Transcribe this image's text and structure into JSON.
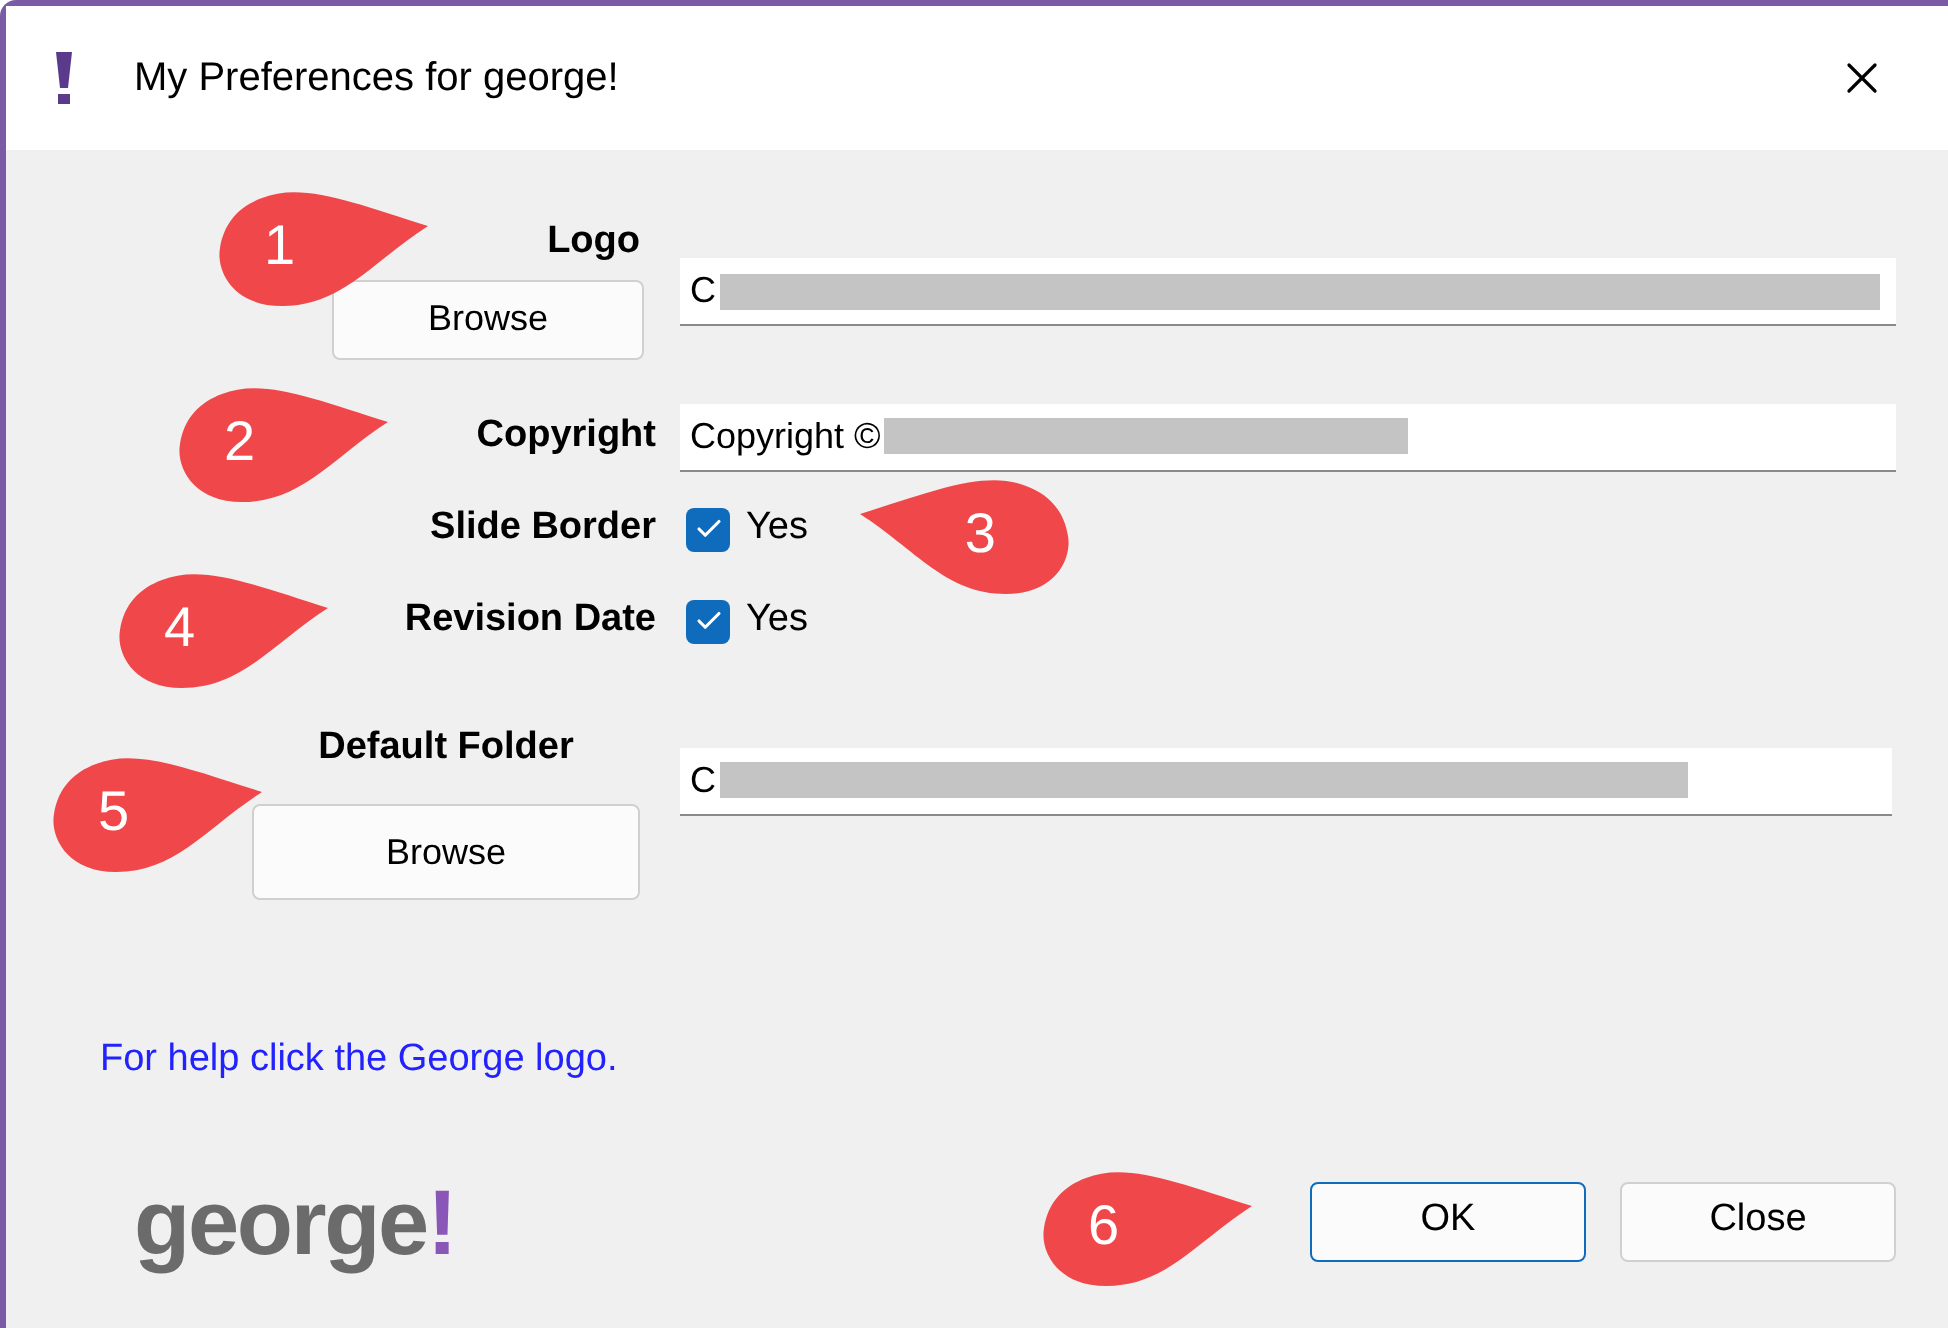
{
  "window": {
    "title": "My Preferences for george!"
  },
  "form": {
    "logo": {
      "label": "Logo",
      "button": "Browse",
      "value_prefix": "C"
    },
    "copyright": {
      "label": "Copyright",
      "value_prefix": "Copyright ©"
    },
    "options": [
      {
        "label": "Slide Border",
        "checked": true,
        "text": "Yes"
      },
      {
        "label": "Revision Date",
        "checked": true,
        "text": "Yes"
      }
    ],
    "default_folder": {
      "label": "Default Folder",
      "button": "Browse",
      "value_prefix": "C"
    }
  },
  "help_link": "For help click the George logo.",
  "brand": {
    "word": "george",
    "mark": "!"
  },
  "buttons": [
    {
      "label": "OK",
      "selected": true
    },
    {
      "label": "Close",
      "selected": false
    }
  ],
  "callouts": [
    {
      "number": "1",
      "kind": "right"
    },
    {
      "number": "2",
      "kind": "right"
    },
    {
      "number": "3",
      "kind": "left"
    },
    {
      "number": "4",
      "kind": "right"
    },
    {
      "number": "5",
      "kind": "right"
    },
    {
      "number": "6",
      "kind": "right"
    }
  ]
}
